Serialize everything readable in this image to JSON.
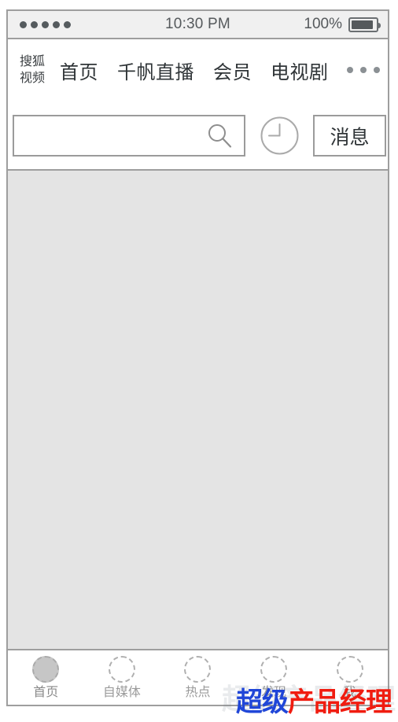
{
  "status_bar": {
    "signal_dots": 5,
    "time": "10:30 PM",
    "battery_percent": "100%",
    "battery_icon": "battery-full-icon"
  },
  "header": {
    "brand": {
      "line1": "搜狐",
      "line2": "视频"
    },
    "nav_items": [
      {
        "label": "首页"
      },
      {
        "label": "千帆直播"
      },
      {
        "label": "会员"
      },
      {
        "label": "电视剧"
      }
    ],
    "more_icon": "ellipsis-icon",
    "search": {
      "value": "",
      "placeholder": "",
      "icon": "search-icon"
    },
    "history_icon": "clock-icon",
    "message_button": "消息"
  },
  "content": {
    "background": "#e4e4e4"
  },
  "tab_bar": {
    "items": [
      {
        "label": "首页",
        "icon": "home-circle-icon",
        "active": true
      },
      {
        "label": "自媒体",
        "icon": "media-circle-icon",
        "active": false
      },
      {
        "label": "热点",
        "icon": "hot-circle-icon",
        "active": false
      },
      {
        "label": "发现",
        "icon": "discover-circle-icon",
        "active": false
      },
      {
        "label": "我",
        "icon": "profile-circle-icon",
        "active": false
      }
    ]
  },
  "watermark": {
    "part_blue": "超级",
    "part_red": "产品经理",
    "ghost": "超级产品经理",
    "color_blue": "#2046d8",
    "color_red": "#f01c10"
  }
}
